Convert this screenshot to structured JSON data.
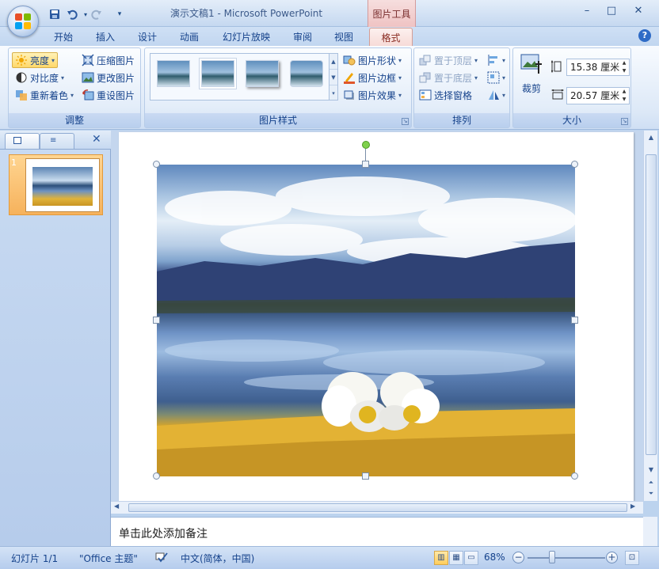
{
  "app": {
    "title": "演示文稿1 - Microsoft PowerPoint",
    "context_tab_header": "图片工具"
  },
  "qat": {
    "save_icon": "save-icon",
    "undo_icon": "undo-icon",
    "redo_icon": "redo-icon",
    "customize_icon": "customize-qat-icon"
  },
  "window_controls": {
    "minimize": "–",
    "maximize": "□",
    "close": "✕"
  },
  "tabs": [
    {
      "label": "开始"
    },
    {
      "label": "插入"
    },
    {
      "label": "设计"
    },
    {
      "label": "动画"
    },
    {
      "label": "幻灯片放映"
    },
    {
      "label": "审阅"
    },
    {
      "label": "视图"
    },
    {
      "label": "格式",
      "active": true
    }
  ],
  "help_glyph": "?",
  "ribbon": {
    "adjust": {
      "label": "调整",
      "brightness": "亮度",
      "contrast": "对比度",
      "recolor": "重新着色",
      "compress": "压缩图片",
      "change_picture": "更改图片",
      "reset_picture": "重设图片"
    },
    "picture_styles": {
      "label": "图片样式",
      "shape": "图片形状",
      "border": "图片边框",
      "effects": "图片效果"
    },
    "arrange": {
      "label": "排列",
      "bring_to_front": "置于顶层",
      "send_to_back": "置于底层",
      "selection_pane": "选择窗格"
    },
    "size": {
      "label": "大小",
      "crop": "裁剪",
      "height": "15.38 厘米",
      "width": "20.57 厘米"
    }
  },
  "slides_pane": {
    "slide_number": "1"
  },
  "notes": {
    "placeholder": "单击此处添加备注"
  },
  "status": {
    "slide": "幻灯片 1/1",
    "theme": "\"Office 主题\"",
    "language": "中文(简体，中国)",
    "zoom": "68%",
    "zoom_level": 0.68
  },
  "colors": {
    "accent": "#15428b",
    "context_tab": "#f6dad6",
    "selected_button": "#ffd86a",
    "rotate_handle": "#7fd14c"
  }
}
